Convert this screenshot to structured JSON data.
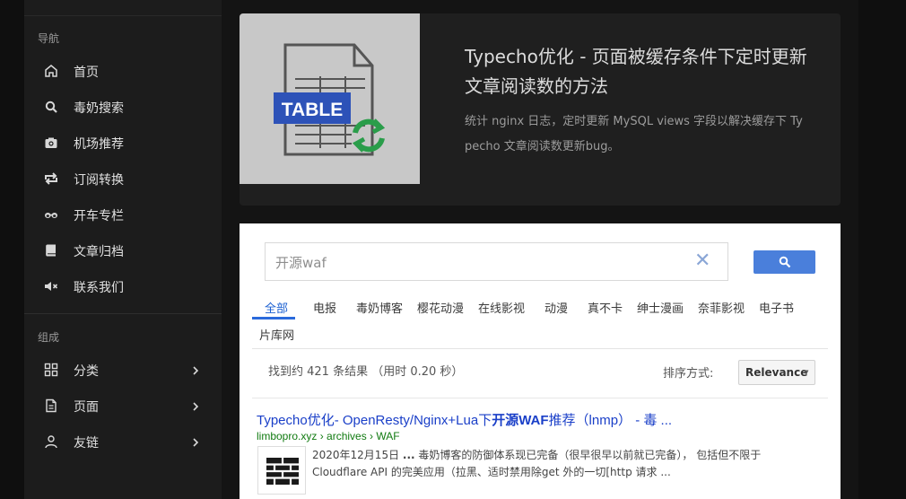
{
  "sidebar": {
    "nav_heading": "导航",
    "nav_items": [
      {
        "label": "首页",
        "icon": "home-icon"
      },
      {
        "label": "毒奶搜索",
        "icon": "search-icon"
      },
      {
        "label": "机场推荐",
        "icon": "camera-icon"
      },
      {
        "label": "订阅转换",
        "icon": "repeat-icon"
      },
      {
        "label": "开车专栏",
        "icon": "glasses-icon"
      },
      {
        "label": "文章归档",
        "icon": "book-icon"
      },
      {
        "label": "联系我们",
        "icon": "mute-icon"
      }
    ],
    "group_heading": "组成",
    "group_items": [
      {
        "label": "分类",
        "icon": "grid-icon"
      },
      {
        "label": "页面",
        "icon": "file-icon"
      },
      {
        "label": "友链",
        "icon": "user-icon"
      }
    ]
  },
  "article": {
    "thumb_text": "TABLE",
    "title": "Typecho优化 - 页面被缓存条件下定时更新文章阅读数的方法",
    "description": "统计 nginx 日志，定时更新 MySQL views 字段以解决缓存下 Typecho 文章阅读数更新bug。"
  },
  "search": {
    "query": "开源waf",
    "clear": "✕",
    "tabs": [
      "全部",
      "电报",
      "毒奶博客",
      "樱花动漫",
      "在线影视",
      "动漫",
      "真不卡",
      "绅士漫画",
      "奈菲影视",
      "电子书",
      "片库网"
    ],
    "result_count": "找到约 421 条结果 （用时 0.20 秒）",
    "sort_label": "排序方式:",
    "sort_value": "Relevance",
    "result": {
      "title_pre": "Typecho优化- OpenResty/Nginx+Lua下",
      "title_bold": "开源WAF",
      "title_post": "推荐（lnmp） - 毒 ...",
      "url": "limbopro.xyz › archives › WAF",
      "snippet_date": "2020年12月15日",
      "snippet_ellipsis": "...",
      "snippet_text": " 毒奶博客的防御体系现已完备（很早很早以前就已完备）， 包括但不限于 Cloudflare API 的完美应用（拉黑、适时禁用除get 外的一切[http 请求 ..."
    }
  },
  "colors": {
    "accent": "#4a7fdb",
    "link": "#1a3fc8",
    "url": "#107a10",
    "refresh": "#2a9d4a",
    "table_banner": "#2d52b8"
  }
}
